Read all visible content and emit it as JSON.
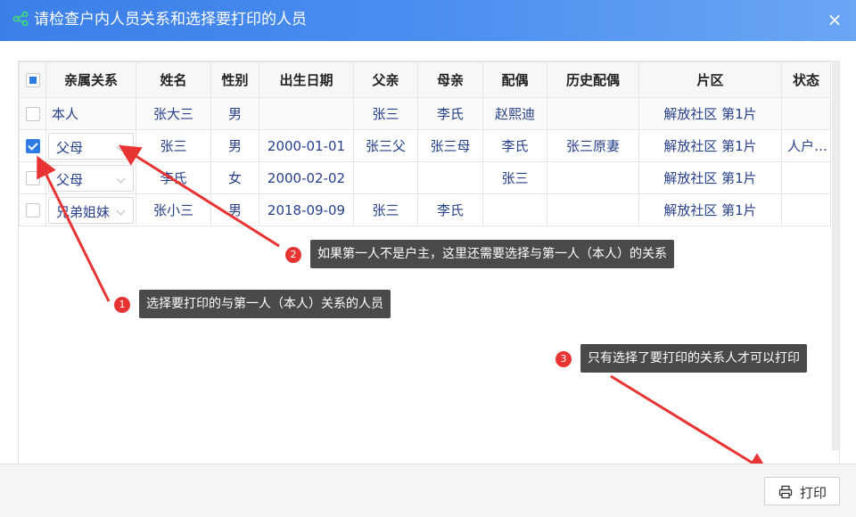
{
  "dialog": {
    "title": "请检查户内人员关系和选择要打印的人员",
    "close_glyph": "×"
  },
  "table": {
    "headers": [
      "亲属关系",
      "姓名",
      "性别",
      "出生日期",
      "父亲",
      "母亲",
      "配偶",
      "历史配偶",
      "片区",
      "状态"
    ],
    "rows": [
      {
        "checked": false,
        "relation": "本人",
        "relation_is_select": false,
        "name": "张大三",
        "gender": "男",
        "birth": "",
        "father": "张三",
        "mother": "李氏",
        "spouse": "赵熙迪",
        "history_spouse": "",
        "area": "解放社区 第1片",
        "status": ""
      },
      {
        "checked": true,
        "relation": "父母",
        "relation_is_select": true,
        "name": "张三",
        "gender": "男",
        "birth": "2000-01-01",
        "father": "张三父",
        "mother": "张三母",
        "spouse": "李氏",
        "history_spouse": "张三原妻",
        "area": "解放社区 第1片",
        "status": "人户…"
      },
      {
        "checked": false,
        "relation": "父母",
        "relation_is_select": true,
        "name": "李氏",
        "gender": "女",
        "birth": "2000-02-02",
        "father": "",
        "mother": "",
        "spouse": "张三",
        "history_spouse": "",
        "area": "解放社区 第1片",
        "status": ""
      },
      {
        "checked": false,
        "relation": "兄弟姐妹",
        "relation_is_select": true,
        "name": "张小三",
        "gender": "男",
        "birth": "2018-09-09",
        "father": "张三",
        "mother": "李氏",
        "spouse": "",
        "history_spouse": "",
        "area": "解放社区 第1片",
        "status": ""
      }
    ]
  },
  "annotations": [
    {
      "num": "1",
      "text": "选择要打印的与第一人（本人）关系的人员"
    },
    {
      "num": "2",
      "text": "如果第一人不是户主，这里还需要选择与第一人（本人）的关系"
    },
    {
      "num": "3",
      "text": "只有选择了要打印的关系人才可以打印"
    }
  ],
  "footer": {
    "print_label": "打印"
  },
  "colors": {
    "titlebar": "#3b7fe8",
    "accent": "#2f7be6",
    "cell_text": "#27408b",
    "arrow": "#e83333",
    "tip_bg": "#4a4a4a"
  }
}
